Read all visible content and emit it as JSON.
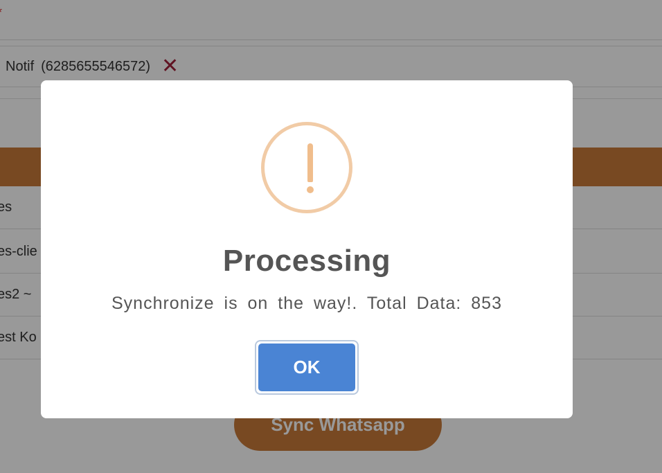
{
  "background": {
    "required_mark": "*",
    "notif": {
      "label": "Notif",
      "phone": "(6285655546572)",
      "remove_icon": "close-x-icon"
    },
    "list_rows": [
      "es",
      "es-clie",
      "es2  ~",
      "est  Ko"
    ],
    "sync_button": "Sync Whatsapp"
  },
  "modal": {
    "icon": "warning-exclamation-icon",
    "title": "Processing",
    "text": "Synchronize is on the way!. Total Data: 853",
    "ok_button": "OK"
  },
  "colors": {
    "accent": "#c97a3a",
    "ok_button": "#4a84d4",
    "warning": "#f0bd8c",
    "remove_icon": "#a0203a"
  }
}
